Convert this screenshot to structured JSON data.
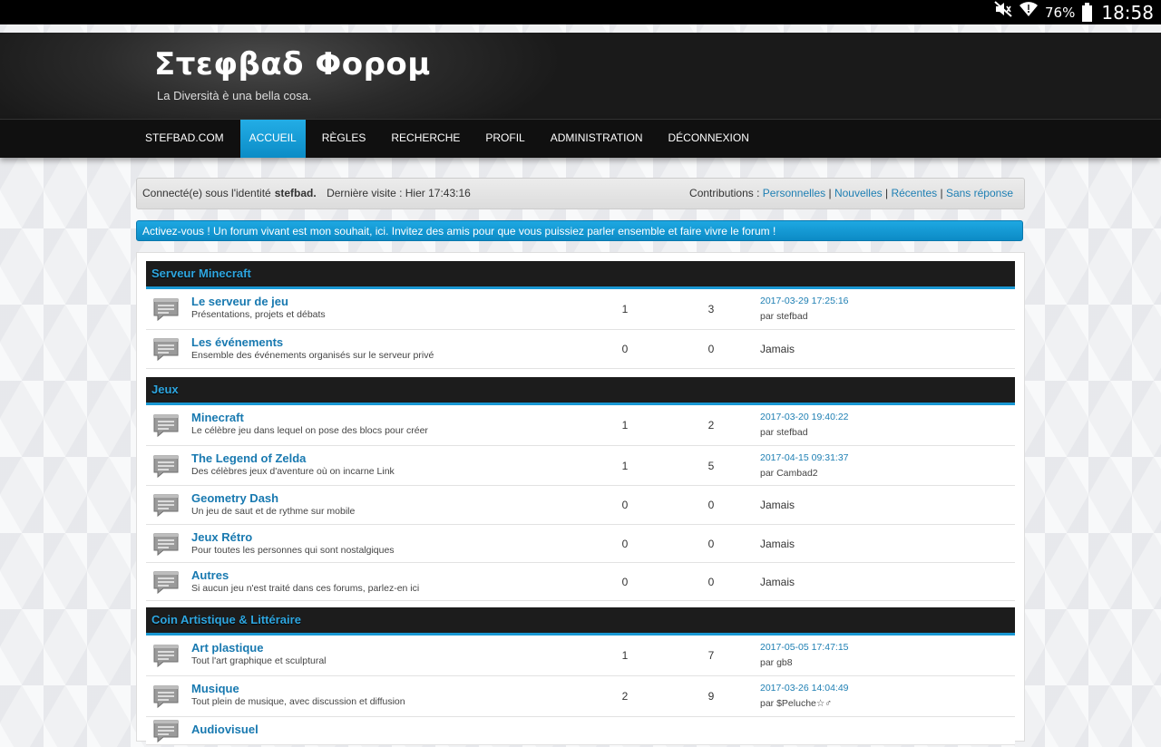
{
  "status_bar": {
    "battery": "76%",
    "time": "18:58",
    "icons": [
      "mute-icon",
      "wifi-icon",
      "battery-icon"
    ]
  },
  "header": {
    "title": "Στεφβαδ Φορομ",
    "description": "La Diversità è una bella cosa."
  },
  "nav": [
    {
      "label": "STEFBAD.COM",
      "active": false
    },
    {
      "label": "ACCUEIL",
      "active": true
    },
    {
      "label": "RÈGLES",
      "active": false
    },
    {
      "label": "RECHERCHE",
      "active": false
    },
    {
      "label": "PROFIL",
      "active": false
    },
    {
      "label": "ADMINISTRATION",
      "active": false
    },
    {
      "label": "DÉCONNEXION",
      "active": false
    }
  ],
  "infobar": {
    "connected_prefix": "Connecté(e) sous l'identité",
    "username": "stefbad.",
    "last_visit": "Dernière visite : Hier 17:43:16",
    "contributions_label": "Contributions :",
    "links": [
      "Personnelles",
      "Nouvelles",
      "Récentes",
      "Sans réponse"
    ]
  },
  "announcement": "Activez-vous ! Un forum vivant est mon souhait, ici. Invitez des amis pour que vous puissiez parler ensemble et faire vivre le forum !",
  "categories": [
    {
      "name": "Serveur Minecraft",
      "forums": [
        {
          "title": "Le serveur de jeu",
          "desc": "Présentations, projets et débats",
          "topics": "1",
          "posts": "3",
          "last_date": "2017-03-29 17:25:16",
          "last_by": "par stefbad"
        },
        {
          "title": "Les événements",
          "desc": "Ensemble des événements organisés sur le serveur privé",
          "topics": "0",
          "posts": "0",
          "never": "Jamais"
        }
      ]
    },
    {
      "name": "Jeux",
      "forums": [
        {
          "title": "Minecraft",
          "desc": "Le célèbre jeu dans lequel on pose des blocs pour créer",
          "topics": "1",
          "posts": "2",
          "last_date": "2017-03-20 19:40:22",
          "last_by": "par stefbad"
        },
        {
          "title": "The Legend of Zelda",
          "desc": "Des célèbres jeux d'aventure où on incarne Link",
          "topics": "1",
          "posts": "5",
          "last_date": "2017-04-15 09:31:37",
          "last_by": "par Cambad2"
        },
        {
          "title": "Geometry Dash",
          "desc": "Un jeu de saut et de rythme sur mobile",
          "topics": "0",
          "posts": "0",
          "never": "Jamais"
        },
        {
          "title": "Jeux Rétro",
          "desc": "Pour toutes les personnes qui sont nostalgiques",
          "topics": "0",
          "posts": "0",
          "never": "Jamais"
        },
        {
          "title": "Autres",
          "desc": "Si aucun jeu n'est traité dans ces forums, parlez-en ici",
          "topics": "0",
          "posts": "0",
          "never": "Jamais"
        }
      ]
    },
    {
      "name": "Coin Artistique & Littéraire",
      "forums": [
        {
          "title": "Art plastique",
          "desc": "Tout l'art graphique et sculptural",
          "topics": "1",
          "posts": "7",
          "last_date": "2017-05-05 17:47:15",
          "last_by": "par gb8"
        },
        {
          "title": "Musique",
          "desc": "Tout plein de musique, avec discussion et diffusion",
          "topics": "2",
          "posts": "9",
          "last_date": "2017-03-26 14:04:49",
          "last_by": "par $Peluche☆♂"
        },
        {
          "title": "Audiovisuel",
          "desc": "",
          "topics": "",
          "posts": ""
        }
      ]
    }
  ],
  "colors": {
    "accent": "#0f9bd8",
    "link": "#1879b0",
    "category_bg": "#1c1c1c",
    "category_text": "#2ea6e0"
  }
}
